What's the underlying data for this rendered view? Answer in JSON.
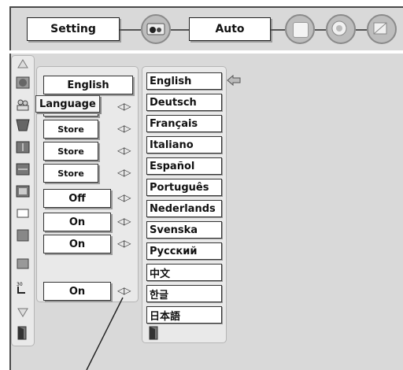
{
  "topbar": {
    "setting_label": "Setting",
    "auto_label": "Auto"
  },
  "menu": {
    "language_value": "English",
    "tooltip": "Language",
    "rows": [
      "Store",
      "Store",
      "Store",
      "Off",
      "On",
      "On"
    ],
    "last_value": "On"
  },
  "languages": [
    "English",
    "Deutsch",
    "Français",
    "Italiano",
    "Español",
    "Português",
    "Nederlands",
    "Svenska",
    "Русский",
    "中文",
    "한글",
    "日本語"
  ],
  "icons": {
    "selected_arrow": "left-arrow-icon",
    "exit": "exit-door-icon"
  }
}
